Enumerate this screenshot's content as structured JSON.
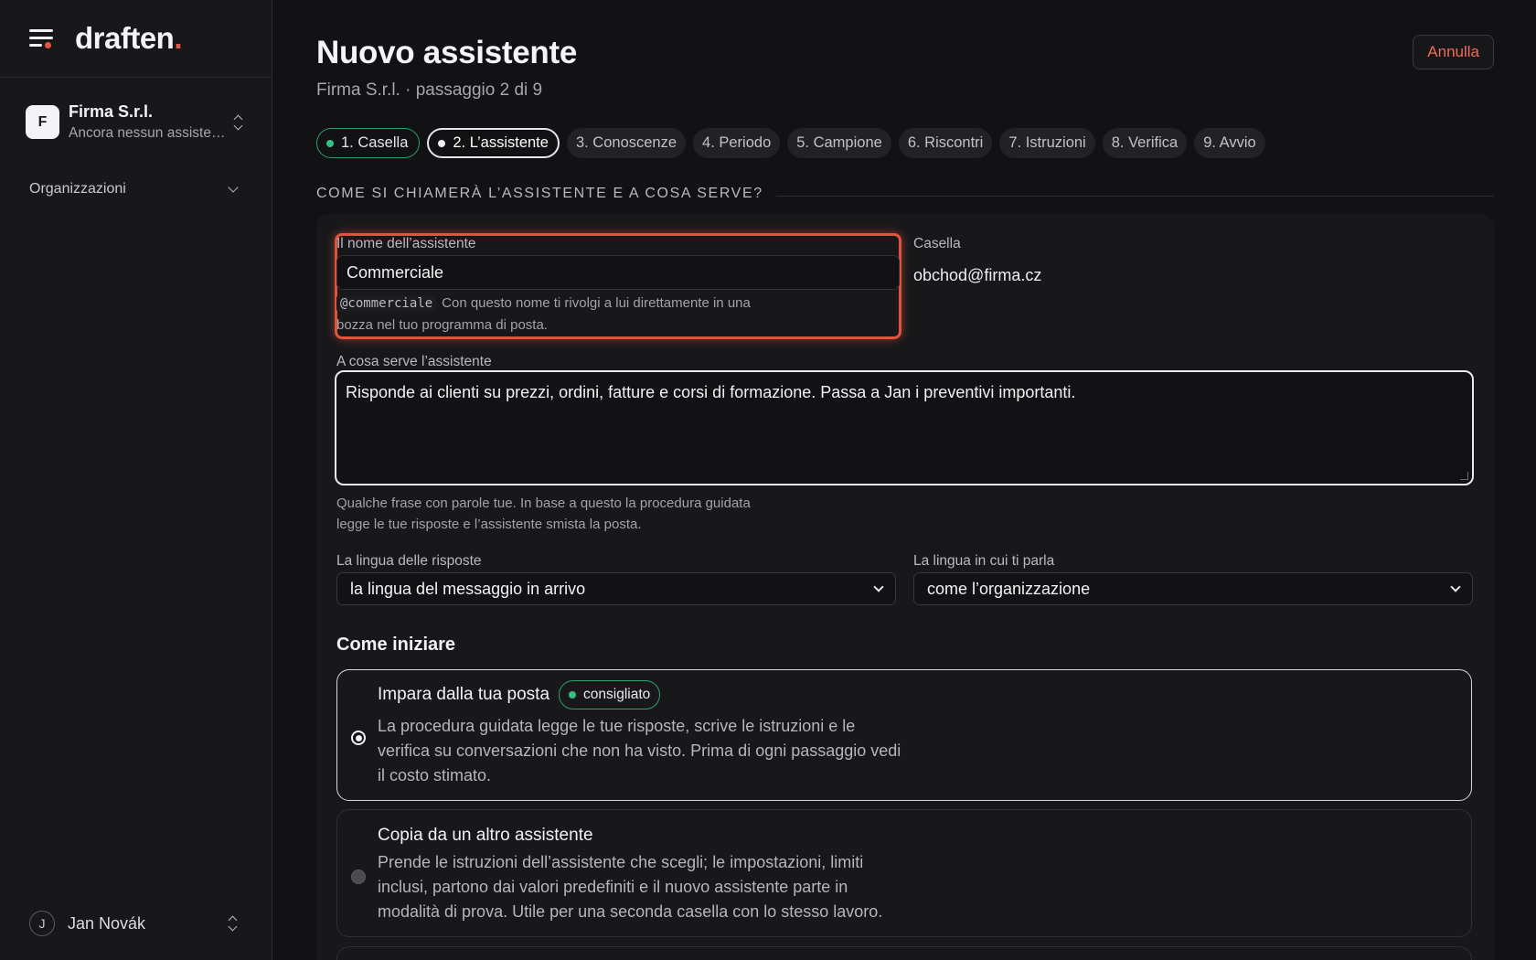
{
  "app": {
    "logo_text": "draften",
    "logo_dot": "."
  },
  "sidebar": {
    "org": {
      "initial": "F",
      "name": "Firma S.r.l.",
      "subtitle": "Ancora nessun assistente"
    },
    "section_label": "Organizzazioni",
    "user": {
      "initial": "J",
      "name": "Jan Novák"
    }
  },
  "header": {
    "title": "Nuovo assistente",
    "subtitle": "Firma S.r.l. · passaggio 2 di 9",
    "cancel_label": "Annulla"
  },
  "steps": [
    {
      "label": "1. Casella",
      "state": "done"
    },
    {
      "label": "2. L’assistente",
      "state": "current"
    },
    {
      "label": "3. Conoscenze",
      "state": "todo"
    },
    {
      "label": "4. Periodo",
      "state": "todo"
    },
    {
      "label": "5. Campione",
      "state": "todo"
    },
    {
      "label": "6. Riscontri",
      "state": "todo"
    },
    {
      "label": "7. Istruzioni",
      "state": "todo"
    },
    {
      "label": "8. Verifica",
      "state": "todo"
    },
    {
      "label": "9. Avvio",
      "state": "todo"
    }
  ],
  "form": {
    "section_title": "COME SI CHIAMERÀ L’ASSISTENTE E A COSA SERVE?",
    "name": {
      "label": "Il nome dell’assistente",
      "value": "Commerciale",
      "handle": "@commerciale",
      "hint_line1": "Con questo nome ti rivolgi a lui direttamente in una",
      "hint_line2": "bozza nel tuo programma di posta."
    },
    "mailbox": {
      "label": "Casella",
      "value": "obchod@firma.cz"
    },
    "purpose": {
      "label": "A cosa serve l’assistente",
      "value": "Risponde ai clienti su prezzi, ordini, fatture e corsi di formazione. Passa a Jan i preventivi importanti.",
      "hint_line1": "Qualche frase con parole tue. In base a questo la procedura guidata",
      "hint_line2": "legge le tue risposte e l’assistente smista la posta."
    },
    "reply_language": {
      "label": "La lingua delle risposte",
      "value": "la lingua del messaggio in arrivo"
    },
    "speak_language": {
      "label": "La lingua in cui ti parla",
      "value": "come l’organizzazione"
    }
  },
  "start": {
    "heading": "Come iniziare",
    "options": [
      {
        "title": "Impara dalla tua posta",
        "badge": "consigliato",
        "selected": true,
        "desc_line1": "La procedura guidata legge le tue risposte, scrive le istruzioni e le",
        "desc_line2": "verifica su conversazioni che non ha visto. Prima di ogni passaggio vedi",
        "desc_line3": "il costo stimato."
      },
      {
        "title": "Copia da un altro assistente",
        "selected": false,
        "desc_line1": "Prende le istruzioni dell’assistente che scegli; le impostazioni, limiti",
        "desc_line2": "inclusi, partono dai valori predefiniti e il nuovo assistente parte in",
        "desc_line3": "modalità di prova. Utile per una seconda casella con lo stesso lavoro."
      }
    ]
  },
  "colors": {
    "accent": "#e8543f",
    "success": "#34c084",
    "background": "#121214",
    "sidebar": "#18181b"
  }
}
